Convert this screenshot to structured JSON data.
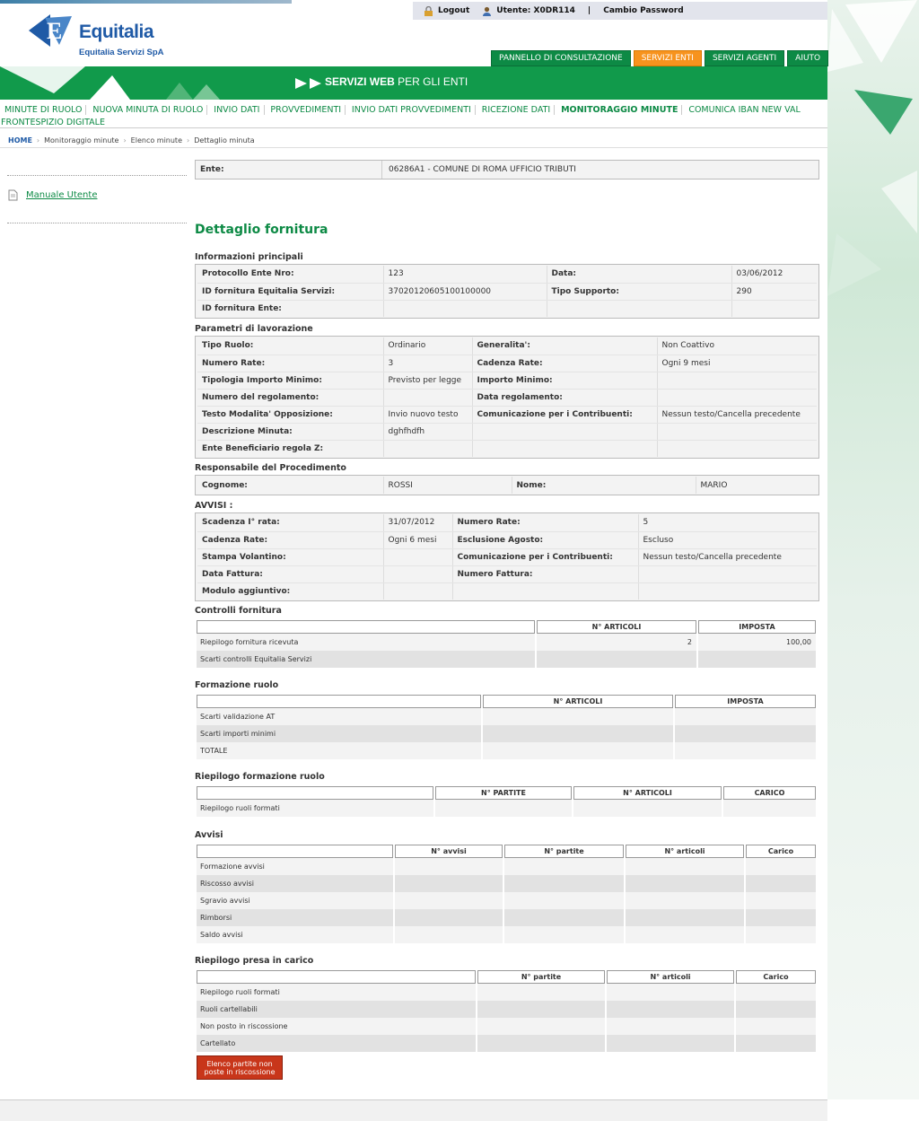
{
  "header": {
    "logo_text": "Equitalia",
    "logo_subtitle": "Equitalia Servizi SpA",
    "logout": "Logout",
    "user": "Utente: X0DR114",
    "change_password": "Cambio Password",
    "tabs": [
      "PANNELLO DI CONSULTAZIONE",
      "SERVIZI ENTI",
      "SERVIZI AGENTI",
      "AIUTO"
    ],
    "active_tab": "SERVIZI ENTI",
    "banner_bold": "SERVIZI WEB",
    "banner_rest": "PER GLI ENTI"
  },
  "menu": [
    "MINUTE DI RUOLO",
    "NUOVA MINUTA DI RUOLO",
    "INVIO DATI",
    "PROVVEDIMENTI",
    "INVIO DATI PROVVEDIMENTI",
    "RICEZIONE DATI",
    "MONITORAGGIO MINUTE",
    "COMUNICA IBAN NEW VAL",
    "FRONTESPIZIO DIGITALE"
  ],
  "breadcrumb": [
    "HOME",
    "Monitoraggio minute",
    "Elenco minute",
    "Dettaglio minuta"
  ],
  "sidebar": {
    "manual": "Manuale Utente"
  },
  "ente": {
    "label": "Ente:",
    "value": "06286A1 - COMUNE DI ROMA UFFICIO TRIBUTI"
  },
  "page_title": "Dettaglio fornitura",
  "info": {
    "heading": "Informazioni principali",
    "rows": [
      [
        "Protocollo Ente Nro:",
        "123",
        "Data:",
        "03/06/2012"
      ],
      [
        "ID fornitura Equitalia Servizi:",
        "37020120605100100000",
        "Tipo Supporto:",
        "290"
      ],
      [
        "ID fornitura Ente:",
        "",
        "",
        ""
      ]
    ]
  },
  "params": {
    "heading": "Parametri di lavorazione",
    "rows": [
      [
        "Tipo Ruolo:",
        "Ordinario",
        "Generalita':",
        "Non Coattivo"
      ],
      [
        "Numero Rate:",
        "3",
        "Cadenza Rate:",
        "Ogni 9 mesi"
      ],
      [
        "Tipologia Importo Minimo:",
        "Previsto per legge",
        "Importo Minimo:",
        ""
      ],
      [
        "Numero del regolamento:",
        "",
        "Data regolamento:",
        ""
      ],
      [
        "Testo Modalita' Opposizione:",
        "Invio nuovo testo",
        "Comunicazione per i Contribuenti:",
        "Nessun testo/Cancella precedente"
      ],
      [
        "Descrizione Minuta:",
        "dghfhdfh",
        "",
        ""
      ],
      [
        "Ente Beneficiario regola Z:",
        "",
        "",
        ""
      ]
    ]
  },
  "resp": {
    "heading": "Responsabile del Procedimento",
    "rows": [
      [
        "Cognome:",
        "ROSSI",
        "Nome:",
        "MARIO"
      ]
    ]
  },
  "avvisi_info": {
    "heading": "AVVISI :",
    "rows": [
      [
        "Scadenza I° rata:",
        "31/07/2012",
        "Numero Rate:",
        "5"
      ],
      [
        "Cadenza Rate:",
        "Ogni 6 mesi",
        "Esclusione Agosto:",
        "Escluso"
      ],
      [
        "Stampa Volantino:",
        "",
        "Comunicazione per i Contribuenti:",
        "Nessun testo/Cancella precedente"
      ],
      [
        "Data Fattura:",
        "",
        "Numero Fattura:",
        ""
      ],
      [
        "Modulo aggiuntivo:",
        "",
        "",
        ""
      ]
    ]
  },
  "controlli": {
    "heading": "Controlli fornitura",
    "cols": [
      "N° ARTICOLI",
      "IMPOSTA"
    ],
    "rows": [
      [
        "Riepilogo fornitura ricevuta",
        "2",
        "100,00"
      ],
      [
        "Scarti controlli Equitalia Servizi",
        "",
        ""
      ]
    ]
  },
  "formazione": {
    "heading": "Formazione ruolo",
    "cols": [
      "N° ARTICOLI",
      "IMPOSTA"
    ],
    "rows": [
      [
        "Scarti validazione AT",
        "",
        ""
      ],
      [
        "Scarti importi minimi",
        "",
        ""
      ],
      [
        "TOTALE",
        "",
        ""
      ]
    ]
  },
  "riepilogo_formazione": {
    "heading": "Riepilogo formazione ruolo",
    "cols": [
      "N° PARTITE",
      "N° ARTICOLI",
      "CARICO"
    ],
    "rows": [
      [
        "Riepilogo ruoli formati",
        "",
        "",
        ""
      ]
    ]
  },
  "avvisi": {
    "heading": "Avvisi",
    "cols": [
      "N° avvisi",
      "N° partite",
      "N° articoli",
      "Carico"
    ],
    "rows": [
      [
        "Formazione avvisi",
        "",
        "",
        "",
        ""
      ],
      [
        "Riscosso avvisi",
        "",
        "",
        "",
        ""
      ],
      [
        "Sgravio avvisi",
        "",
        "",
        "",
        ""
      ],
      [
        "Rimborsi",
        "",
        "",
        "",
        ""
      ],
      [
        "Saldo avvisi",
        "",
        "",
        "",
        ""
      ]
    ]
  },
  "presa_carico": {
    "heading": "Riepilogo presa in carico",
    "cols": [
      "N° partite",
      "N° articoli",
      "Carico"
    ],
    "rows": [
      [
        "Riepilogo ruoli formati",
        "",
        "",
        ""
      ],
      [
        "Ruoli cartellabili",
        "",
        "",
        ""
      ],
      [
        "Non posto in riscossione",
        "",
        "",
        ""
      ],
      [
        "Cartellato",
        "",
        "",
        ""
      ]
    ]
  },
  "button": {
    "label": "Elenco partite non poste in riscossione"
  }
}
